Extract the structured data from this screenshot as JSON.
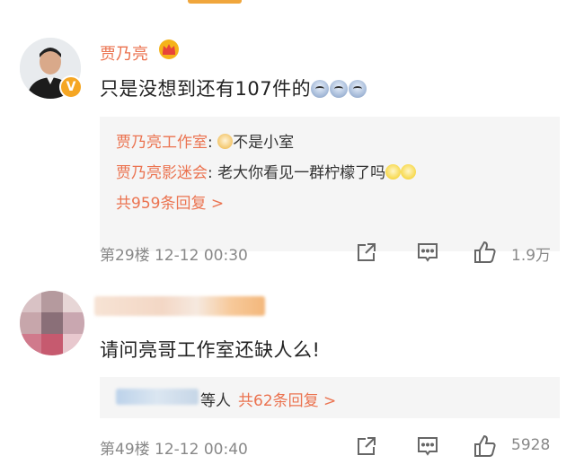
{
  "comments": [
    {
      "author": "贾乃亮",
      "text": "只是没想到还有107件的",
      "replies": [
        {
          "who": "贾乃亮工作室",
          "msg": "不是小室"
        },
        {
          "who": "贾乃亮影迷会",
          "msg": "老大你看见一群柠檬了吗"
        }
      ],
      "more_replies": "共959条回复 >",
      "floor_time": "第29楼  12-12 00:30",
      "likes": "1.9万"
    },
    {
      "author": "",
      "text": "请问亮哥工作室还缺人么!",
      "reply_summary_msg": "等人",
      "reply_summary_count": "共62条回复 >",
      "floor_time": "第49楼  12-12 00:40",
      "likes": "5928"
    }
  ],
  "colors": {
    "accent": "#eb7350",
    "meta": "#888888",
    "reply_bg": "#f5f5f5"
  },
  "icons": [
    "crown-badge-icon",
    "verified-icon",
    "share-icon",
    "comment-icon",
    "like-icon"
  ]
}
